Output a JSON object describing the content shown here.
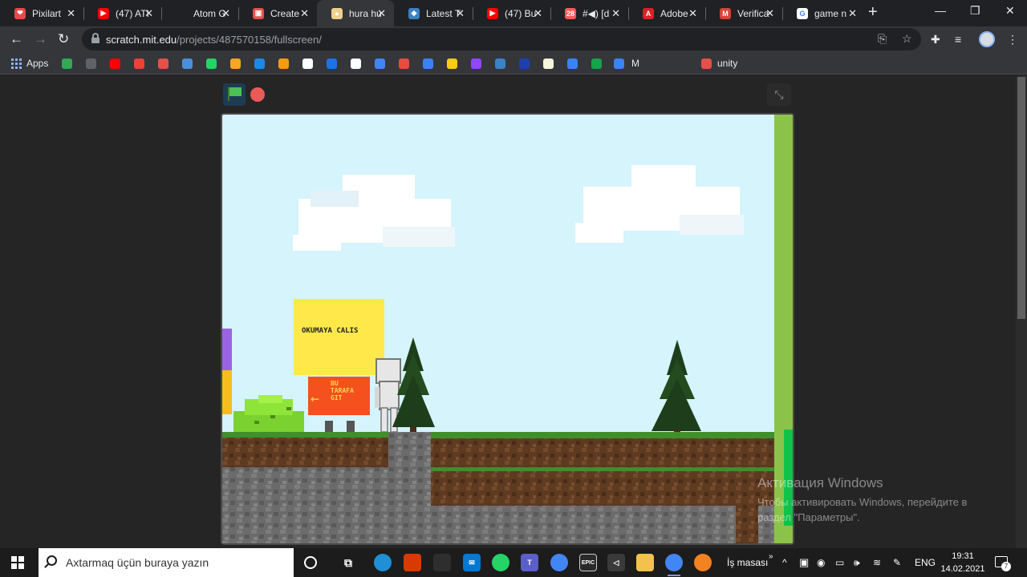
{
  "browser": {
    "tabs": [
      {
        "title": "Pixilart",
        "color": "#e64a4a",
        "glyph": "❤"
      },
      {
        "title": "(47) ATI",
        "color": "#ff0000",
        "glyph": "▶"
      },
      {
        "title": "Atom G",
        "color": "#202124",
        "glyph": ""
      },
      {
        "title": "Create",
        "color": "#e4514a",
        "glyph": "▣"
      },
      {
        "title": "hura hu",
        "color": "#f0d08c",
        "glyph": "●"
      },
      {
        "title": "Latest T",
        "color": "#3b82c4",
        "glyph": "◆"
      },
      {
        "title": "(47) Bu",
        "color": "#ff0000",
        "glyph": "▶"
      },
      {
        "title": "#◀) [d",
        "color": "#ff5a5a",
        "glyph": "28"
      },
      {
        "title": "Adobe",
        "color": "#e01f26",
        "glyph": "A"
      },
      {
        "title": "Verifica",
        "color": "#d44638",
        "glyph": "M"
      },
      {
        "title": "game n",
        "color": "#ffffff",
        "glyph": "G"
      }
    ],
    "active_tab": 4,
    "url_host": "scratch.mit.edu",
    "url_path": "/projects/487570158/fullscreen/",
    "bookmarks": {
      "apps_label": "Apps",
      "m_label": "M",
      "unity_label": "unity",
      "icon_colors": [
        "#34a853",
        "#5f6368",
        "#ff0000",
        "#ea4335",
        "#e4514a",
        "#4a90d9",
        "#25d366",
        "#f5a623",
        "#1e88e5",
        "#f39c12",
        "#ffffff",
        "#1a73e8",
        "#ffffff",
        "#4285f4",
        "#e74c3c",
        "#3b82f6",
        "#facc15",
        "#9146ff",
        "#3b82c4",
        "#1e40af",
        "#f5f5dc",
        "#3b82f6",
        "#16a34a",
        "#3b82f6"
      ]
    }
  },
  "scratch": {
    "sign_yellow": "OKUMAYA CALIS",
    "sign_orange": [
      "BU",
      "TARAFA",
      "GIT"
    ]
  },
  "watermark": {
    "line1": "Активация Windows",
    "line2": "Чтобы активировать Windows, перейдите в",
    "line3": "раздел \"Параметры\"."
  },
  "taskbar": {
    "search_placeholder": "Axtarmaq üçün buraya yazın",
    "desktop_label": "İş masası",
    "chevron": "»",
    "lang": "ENG",
    "time": "19:31",
    "date": "14.02.2021",
    "notif_count": "7"
  }
}
